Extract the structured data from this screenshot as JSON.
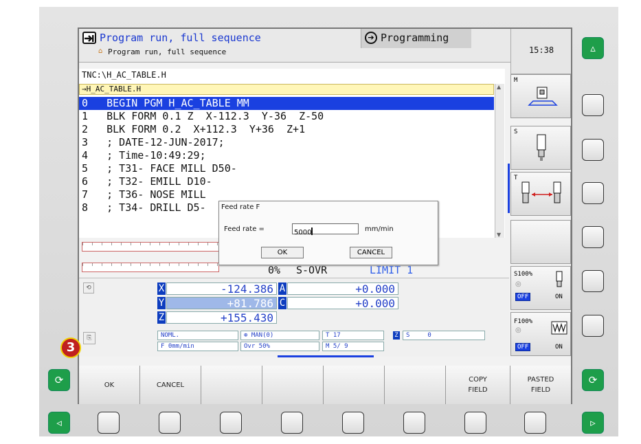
{
  "header": {
    "mode_title": "Program run, full sequence",
    "mode_subtitle": "Program run, full sequence",
    "programming_label": "Programming",
    "clock": "15:38"
  },
  "program": {
    "path": "TNC:\\H_AC_TABLE.H",
    "file_tab": "→H_AC_TABLE.H",
    "lines": [
      "0   BEGIN PGM H_AC_TABLE MM",
      "1   BLK FORM 0.1 Z  X-112.3  Y-36  Z-50",
      "2   BLK FORM 0.2  X+112.3  Y+36  Z+1",
      "3   ; DATE-12-JUN-2017;",
      "4   ; Time-10:49:29;",
      "5   ; T31- FACE MILL D50-",
      "6   ; T32- EMILL D10-",
      "7   ; T36- NOSE MILL",
      "8   ; T34- DRILL D5-"
    ]
  },
  "dialog": {
    "title": "Feed rate F",
    "field_label": "Feed rate =",
    "field_value": "5000",
    "unit": "mm/min",
    "ok_label": "OK",
    "cancel_label": "CANCEL"
  },
  "override": {
    "percent": "0%",
    "label": "S-OVR",
    "limit": "LIMIT 1"
  },
  "positions": [
    {
      "axis": "X",
      "value": "-124.386"
    },
    {
      "axis": "Y",
      "value": "+81.786"
    },
    {
      "axis": "Z",
      "value": "+155.430"
    },
    {
      "axis": "A",
      "value": "+0.000"
    },
    {
      "axis": "C",
      "value": "+0.000"
    }
  ],
  "status": {
    "noml": "NOML.",
    "man": "MAN(0)",
    "tool": "T 17",
    "tool_axis": "Z",
    "spindle": "S",
    "spindle_val": "0",
    "feed": "F  0mm/min",
    "ovr": "Ovr  50%",
    "m": "M 5/ 9"
  },
  "vertical_softkeys": {
    "m": "M",
    "s": "S",
    "t": "T",
    "s_override": "S100%",
    "f_override": "F100%",
    "off": "OFF",
    "on": "ON"
  },
  "softkeys": [
    "OK",
    "CANCEL",
    "",
    "",
    "",
    "",
    "COPY\nFIELD",
    "PASTED\nFIELD"
  ],
  "badge": "3",
  "colors": {
    "accent": "#0d3dbf",
    "green": "#1e9e4a",
    "badge": "#c0201f"
  }
}
